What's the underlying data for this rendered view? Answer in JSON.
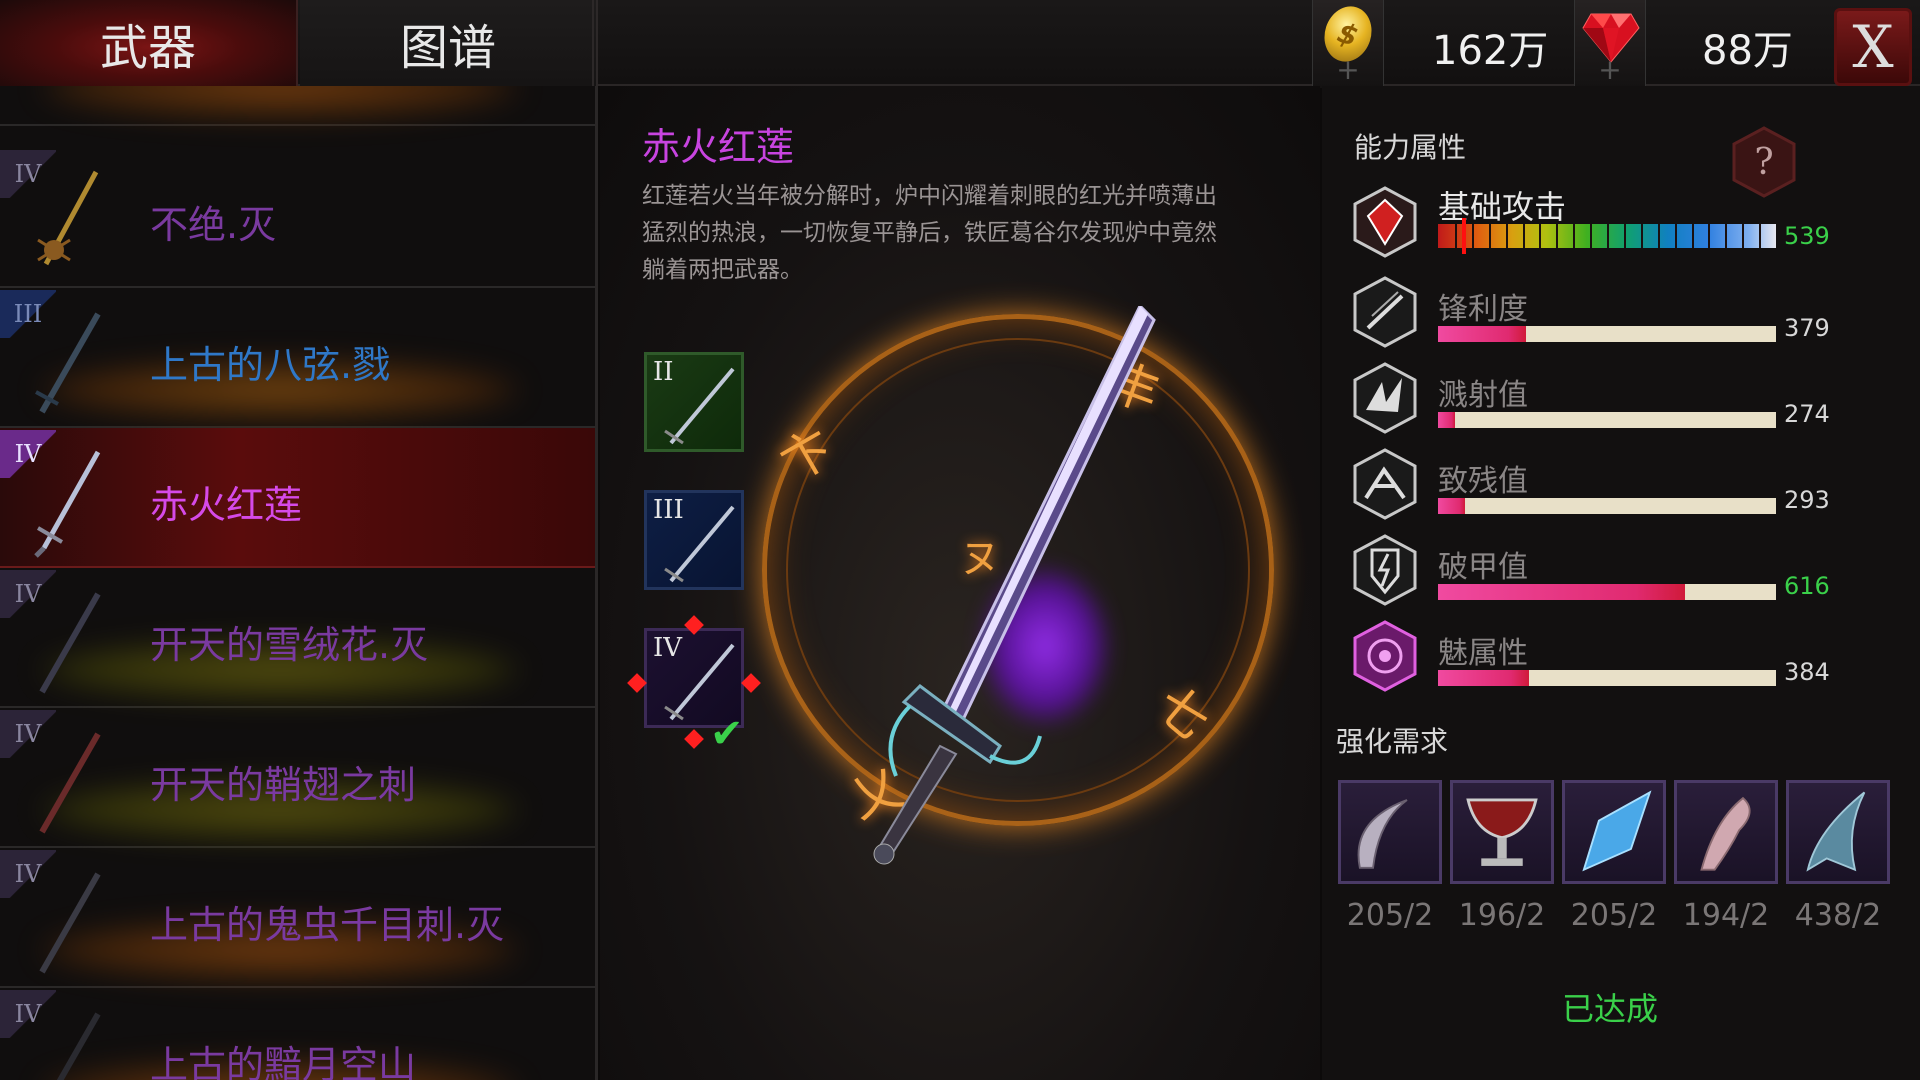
{
  "tabs": [
    {
      "label": "武器",
      "active": true
    },
    {
      "label": "图谱",
      "active": false
    }
  ],
  "currency": {
    "gold": "162万",
    "gems": "88万",
    "gold_symbol": "$",
    "plus": "+"
  },
  "close_label": "X",
  "weapon_list": [
    {
      "rank": "IV",
      "name": "不绝.灭",
      "color": "purple"
    },
    {
      "rank": "III",
      "name": "上古的八弦.戮",
      "color": "blue"
    },
    {
      "rank": "IV",
      "name": "赤火红莲",
      "color": "purple",
      "active": true
    },
    {
      "rank": "IV",
      "name": "开天的雪绒花.灭",
      "color": "purple"
    },
    {
      "rank": "IV",
      "name": "开天的鞘翅之刺",
      "color": "purple"
    },
    {
      "rank": "IV",
      "name": "上古的鬼虫千目刺.灭",
      "color": "purple"
    },
    {
      "rank": "IV",
      "name": "上古的黯月空山",
      "color": "purple"
    }
  ],
  "detail": {
    "title": "赤火红莲",
    "description": "红莲若火当年被分解时，炉中闪耀着刺眼的红光并喷薄出猛烈的热浪，一切恢复平静后，铁匠葛谷尔发现炉中竟然躺着两把武器。",
    "ranks": [
      "II",
      "III",
      "IV"
    ]
  },
  "stats": {
    "section_title": "能力属性",
    "help_symbol": "?",
    "items": [
      {
        "label": "基础攻击",
        "value": "539",
        "fraction": 0.07,
        "highlight": true,
        "icon": "attack-icon"
      },
      {
        "label": "锋利度",
        "value": "379",
        "fraction": 0.26,
        "highlight": false,
        "icon": "sharpness-icon"
      },
      {
        "label": "溅射值",
        "value": "274",
        "fraction": 0.05,
        "highlight": false,
        "icon": "splash-icon"
      },
      {
        "label": "致残值",
        "value": "293",
        "fraction": 0.08,
        "highlight": false,
        "icon": "cripple-icon"
      },
      {
        "label": "破甲值",
        "value": "616",
        "fraction": 0.73,
        "highlight": true,
        "icon": "armor-break-icon"
      },
      {
        "label": "魅属性",
        "value": "384",
        "fraction": 0.27,
        "highlight": false,
        "icon": "charm-icon"
      }
    ]
  },
  "upgrade": {
    "section_title": "强化需求",
    "materials": [
      {
        "count": "205/2",
        "icon": "claw-icon"
      },
      {
        "count": "196/2",
        "icon": "chalice-icon"
      },
      {
        "count": "205/2",
        "icon": "crystal-icon"
      },
      {
        "count": "194/2",
        "icon": "horn-icon"
      },
      {
        "count": "438/2",
        "icon": "fin-icon"
      }
    ],
    "status": "已达成"
  },
  "runes": [
    "卞",
    "丰",
    "七",
    "乂",
    "ヌ"
  ]
}
